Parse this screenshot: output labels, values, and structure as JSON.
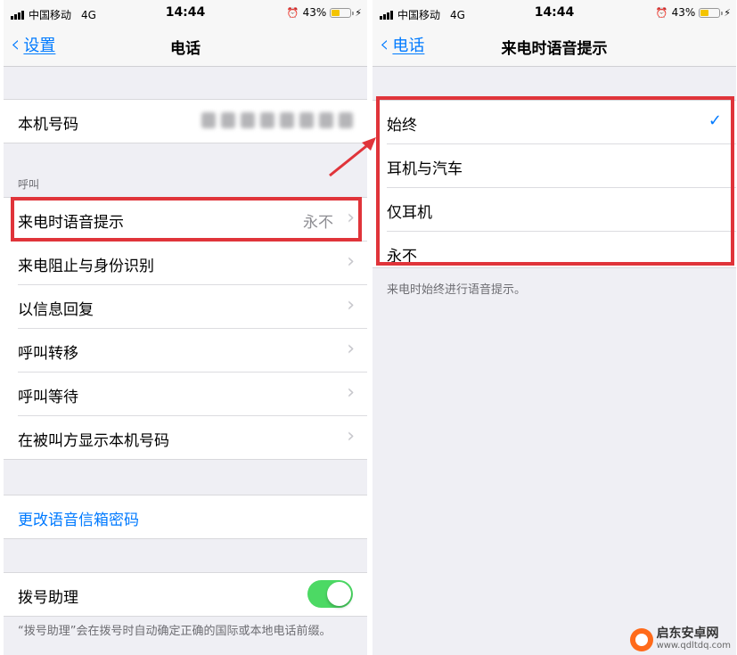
{
  "status_bar": {
    "carrier": "中国移动",
    "network": "4G",
    "time": "14:44",
    "battery": "43%",
    "battery_level": 0.43
  },
  "left_screen": {
    "back_label": "设置",
    "title": "电话",
    "my_number_label": "本机号码",
    "calls_header": "呼叫",
    "announce_calls": {
      "label": "来电时语音提示",
      "value": "永不"
    },
    "call_rows": [
      "来电阻止与身份识别",
      "以信息回复",
      "呼叫转移",
      "呼叫等待",
      "在被叫方显示本机号码"
    ],
    "voicemail_link": "更改语音信箱密码",
    "dial_assist": {
      "label": "拨号助理",
      "on": true
    },
    "dial_assist_footnote": "“拨号助理”会在拨号时自动确定正确的国际或本地电话前缀。"
  },
  "right_screen": {
    "back_label": "电话",
    "title": "来电时语音提示",
    "options": [
      {
        "label": "始终",
        "selected": true
      },
      {
        "label": "耳机与汽车",
        "selected": false
      },
      {
        "label": "仅耳机",
        "selected": false
      },
      {
        "label": "永不",
        "selected": false
      }
    ],
    "footnote": "来电时始终进行语音提示。"
  },
  "watermark": {
    "title": "启东安卓网",
    "url": "www.qdltdq.com"
  },
  "colors": {
    "accent": "#007aff",
    "highlight": "#e0343a",
    "toggle_on": "#4cd964"
  }
}
